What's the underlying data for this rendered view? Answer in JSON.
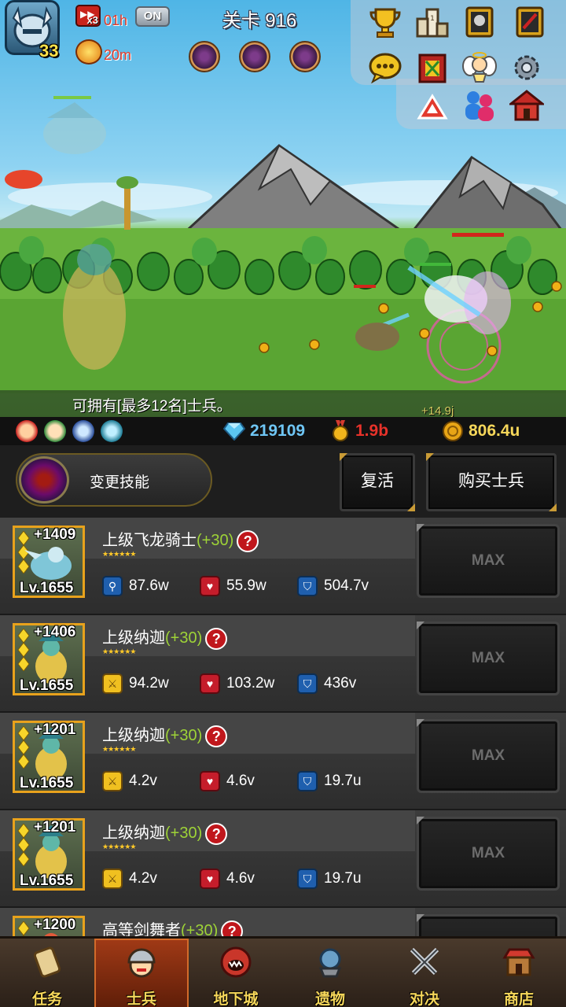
{
  "header": {
    "hero_level": "33",
    "speed_badge": "x3",
    "speed_timer": "01h",
    "auto_toggle": "ON",
    "buff_timer": "20m",
    "stage_label": "关卡 916"
  },
  "battle": {
    "notice": "可拥有[最多12名]士兵。",
    "floating_gain": "+14.9j"
  },
  "resources": {
    "diamonds": "219109",
    "medals": "1.9b",
    "gold": "806.4u"
  },
  "actions": {
    "change_skill": "变更技能",
    "revive": "复活",
    "buy_soldier": "购买士兵"
  },
  "units": [
    {
      "name": "上级飞龙骑士",
      "bonus": "(+30)",
      "plus": "+1409",
      "level": "Lv.1655",
      "attack": "87.6w",
      "hp": "55.9w",
      "defense": "504.7v",
      "button": "MAX",
      "attack_icon": "magnifier-icon"
    },
    {
      "name": "上级纳迦",
      "bonus": "(+30)",
      "plus": "+1406",
      "level": "Lv.1655",
      "attack": "94.2w",
      "hp": "103.2w",
      "defense": "436v",
      "button": "MAX",
      "attack_icon": "sword-icon"
    },
    {
      "name": "上级纳迦",
      "bonus": "(+30)",
      "plus": "+1201",
      "level": "Lv.1655",
      "attack": "4.2v",
      "hp": "4.6v",
      "defense": "19.7u",
      "button": "MAX",
      "attack_icon": "sword-icon"
    },
    {
      "name": "上级纳迦",
      "bonus": "(+30)",
      "plus": "+1201",
      "level": "Lv.1655",
      "attack": "4.2v",
      "hp": "4.6v",
      "defense": "19.7u",
      "button": "MAX",
      "attack_icon": "sword-icon"
    },
    {
      "name": "高等剑舞者",
      "bonus": "(+30)",
      "plus": "+1200",
      "level": "",
      "attack": "",
      "hp": "",
      "defense": "",
      "button": "",
      "attack_icon": "sword-icon"
    }
  ],
  "nav": {
    "quests": "任务",
    "soldiers": "士兵",
    "dungeon": "地下城",
    "relics": "遗物",
    "duel": "对决",
    "shop": "商店",
    "active": "soldiers"
  },
  "colors": {
    "bonus_green": "#9ed337",
    "gold_text": "#f6d75a",
    "diamond_text": "#6fc6f5",
    "medal_text": "#e8322a"
  }
}
